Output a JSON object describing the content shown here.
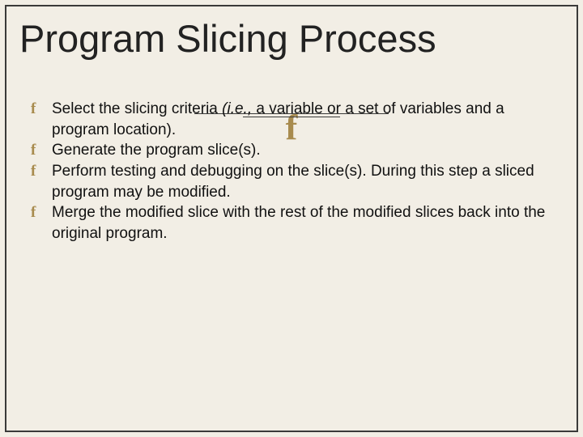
{
  "title": "Program Slicing Process",
  "watermark_glyph": "Ԗ",
  "bullet_glyph": "Ԗ",
  "items": [
    {
      "prefix": "Select the slicing criteria ",
      "italic": "(i.e.,",
      "suffix": " a variable or a set of variables and a program location)."
    },
    {
      "text": "Generate the program slice(s)."
    },
    {
      "text": "Perform testing and debugging on the slice(s). During this step a sliced program may be modified."
    },
    {
      "text": "Merge the modified slice with the rest of the modified slices back into the original program."
    }
  ]
}
